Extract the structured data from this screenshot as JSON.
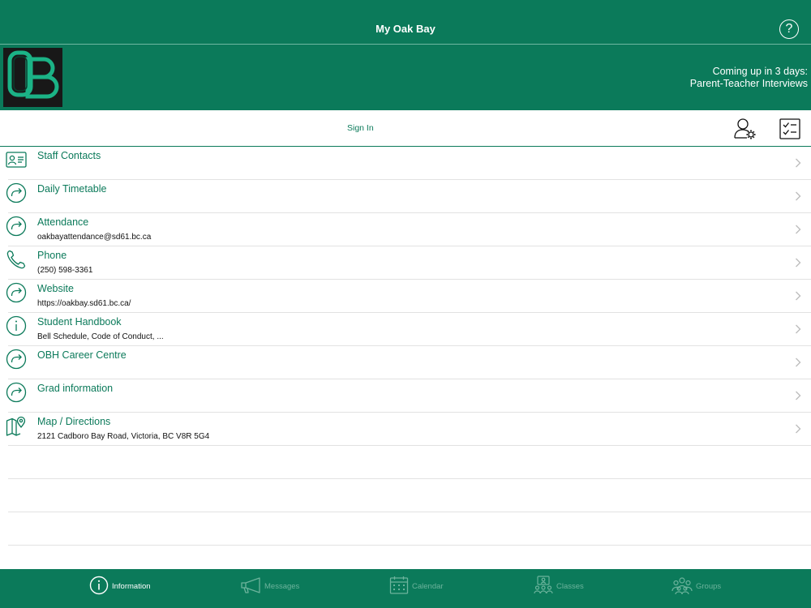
{
  "header": {
    "title": "My Oak Bay",
    "help_icon": "question-circle-icon",
    "help_label": "?"
  },
  "banner": {
    "logo": "ob-school-logo",
    "coming_up_line1": "Coming up in 3 days:",
    "coming_up_line2": "Parent-Teacher Interviews"
  },
  "signbar": {
    "sign_in_label": "Sign In",
    "account_icon": "user-settings-icon",
    "tasks_icon": "checklist-icon"
  },
  "list": [
    {
      "icon": "contact-card-icon",
      "label": "Staff Contacts",
      "sub": ""
    },
    {
      "icon": "redirect-arrow-icon",
      "label": "Daily  Timetable",
      "sub": ""
    },
    {
      "icon": "redirect-arrow-icon",
      "label": "Attendance",
      "sub": "oakbayattendance@sd61.bc.ca"
    },
    {
      "icon": "phone-icon",
      "label": "Phone",
      "sub": "(250) 598-3361"
    },
    {
      "icon": "redirect-arrow-icon",
      "label": "Website",
      "sub": "https://oakbay.sd61.bc.ca/"
    },
    {
      "icon": "info-icon",
      "label": "Student Handbook",
      "sub": "Bell Schedule, Code of Conduct, ..."
    },
    {
      "icon": "redirect-arrow-icon",
      "label": "OBH Career Centre",
      "sub": ""
    },
    {
      "icon": "redirect-arrow-icon",
      "label": "Grad information",
      "sub": ""
    },
    {
      "icon": "map-pin-icon",
      "label": "Map / Directions",
      "sub": "2121 Cadboro Bay Road, Victoria, BC V8R 5G4"
    }
  ],
  "tabs": [
    {
      "icon": "info-icon",
      "label": "Information",
      "active": true
    },
    {
      "icon": "megaphone-icon",
      "label": "Messages",
      "active": false
    },
    {
      "icon": "calendar-icon",
      "label": "Calendar",
      "active": false
    },
    {
      "icon": "classes-icon",
      "label": "Classes",
      "active": false
    },
    {
      "icon": "groups-icon",
      "label": "Groups",
      "active": false
    }
  ],
  "colors": {
    "brand_green": "#0b7a5a",
    "inactive_tab": "#6cb39c",
    "logo_bg": "#181818",
    "logo_green": "#1bb386"
  }
}
